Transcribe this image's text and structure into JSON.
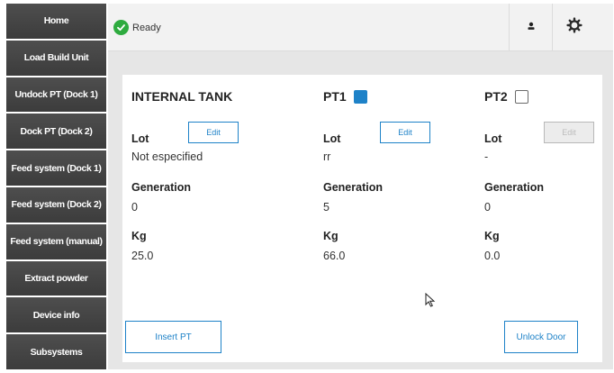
{
  "sidebar": {
    "items": [
      {
        "label": "Home"
      },
      {
        "label": "Load Build Unit"
      },
      {
        "label": "Undock PT (Dock 1)"
      },
      {
        "label": "Dock PT (Dock 2)"
      },
      {
        "label": "Feed system (Dock 1)"
      },
      {
        "label": "Feed system (Dock 2)"
      },
      {
        "label": "Feed system (manual)"
      },
      {
        "label": "Extract powder"
      },
      {
        "label": "Device info"
      },
      {
        "label": "Subsystems"
      }
    ]
  },
  "status": {
    "text": "Ready",
    "color": "#2eab3f",
    "icon": "check-icon"
  },
  "toolbar": {
    "user_icon": "user-icon",
    "settings_icon": "gear-icon"
  },
  "columns": [
    {
      "title": "INTERNAL TANK",
      "lot_label": "Lot",
      "edit_label": "Edit",
      "lot_value": "Not especified",
      "generation_label": "Generation",
      "generation_value": "0",
      "kg_label": "Kg",
      "kg_value": "25.0"
    },
    {
      "title": "PT1",
      "checked": true,
      "lot_label": "Lot",
      "edit_label": "Edit",
      "lot_value": "rr",
      "generation_label": "Generation",
      "generation_value": "5",
      "kg_label": "Kg",
      "kg_value": "66.0"
    },
    {
      "title": "PT2",
      "checked": false,
      "lot_label": "Lot",
      "edit_label": "Edit",
      "edit_disabled": true,
      "lot_value": "-",
      "generation_label": "Generation",
      "generation_value": "0",
      "kg_label": "Kg",
      "kg_value": "0.0"
    }
  ],
  "actions": {
    "insert_label": "Insert PT",
    "unlock_label": "Unlock Door"
  },
  "colors": {
    "accent": "#1e82c8",
    "sidebar": "#444444"
  }
}
